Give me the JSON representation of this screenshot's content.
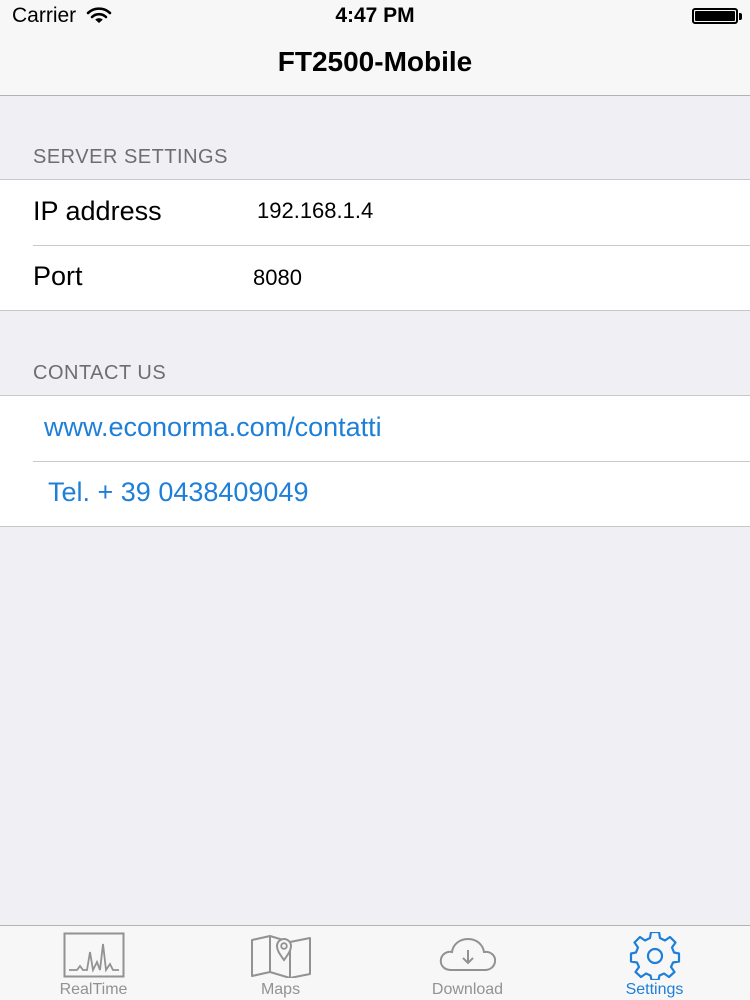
{
  "status_bar": {
    "carrier": "Carrier",
    "time": "4:47 PM"
  },
  "nav": {
    "title": "FT2500-Mobile"
  },
  "server_settings": {
    "header": "SERVER SETTINGS",
    "rows": [
      {
        "label": "IP address",
        "value": "192.168.1.4"
      },
      {
        "label": "Port",
        "value": "8080"
      }
    ]
  },
  "contact": {
    "header": "CONTACT US",
    "website": "www.econorma.com/contatti",
    "phone": "Tel. + 39 0438409049"
  },
  "tabs": [
    {
      "label": "RealTime",
      "icon": "chart-icon"
    },
    {
      "label": "Maps",
      "icon": "map-icon"
    },
    {
      "label": "Download",
      "icon": "cloud-download-icon"
    },
    {
      "label": "Settings",
      "icon": "gear-icon"
    }
  ],
  "colors": {
    "accent": "#1e7fd8",
    "background": "#efeff4",
    "inactive_tab": "#929292"
  }
}
